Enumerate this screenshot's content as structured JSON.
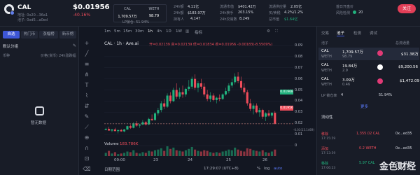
{
  "token": {
    "symbol": "CAL",
    "address_line": "地址: 0x20...36a1",
    "pair_line": "池子: 0xd5...a0ed",
    "price": "$0.01956",
    "change": "-40.16%",
    "lp_lock": "LP锁仓: 51.94%"
  },
  "pair_box": {
    "base": "CAL",
    "quote": "WETH",
    "base_amount": "1,709.57万",
    "quote_amount": "98.79"
  },
  "stats": [
    {
      "label": "24h额",
      "value": "4.11亿"
    },
    {
      "label": "24h额",
      "value": "$183.97万"
    },
    {
      "label": "持有人",
      "value": "4,147"
    },
    {
      "label": "流通市值",
      "value": "$401.42万"
    },
    {
      "label": "24h换手",
      "value": "203.15%"
    },
    {
      "label": "24h交易数",
      "value": "8,249"
    },
    {
      "label": "流通供应量",
      "value": "2.05亿"
    },
    {
      "label": "买/卖税",
      "value": "4.2%/1.2%"
    },
    {
      "label": "总市值",
      "value": "$1.64亿"
    },
    {
      "label": "首日开盘价",
      "value": ""
    },
    {
      "label": "风险检测",
      "value": "20"
    }
  ],
  "follow": "关注",
  "left_tabs": [
    "自选",
    "热门币",
    "涨幅榜",
    "新币榜"
  ],
  "left_group": "默认分组",
  "left_cols": {
    "coin": "币种",
    "price": "价格(货币)",
    "change": "24h涨跌幅"
  },
  "left_empty": "暂无数据",
  "timeframes": [
    "1m",
    "5m",
    "15m",
    "30m",
    "1h",
    "4h",
    "1D",
    "1W"
  ],
  "chart_toolbar": {
    "indicator": "指标",
    "settings": "⚙",
    "snapshot": "截图",
    "fullscreen": "⛶"
  },
  "legend": {
    "pair": "CAL · 1h · Ave.ai",
    "ohlc": "开=0.02139 高=0.02139 低=0.01834 收=0.01956 -0.00183(-8.5509%)"
  },
  "price_axis": [
    "0.09",
    "0.08",
    "0.07",
    "0.06",
    "0.05",
    "0.04",
    "0.03",
    "0.02",
    "0.01",
    "0",
    "-0.01(13.1469)"
  ],
  "price_tags": {
    "a": "0.01968",
    "b": "0.01956"
  },
  "time_axis": [
    "09:00",
    "23",
    "24",
    "25",
    "26"
  ],
  "volume_label": "Volume",
  "volume_value": "183.786K",
  "bottom_bar": {
    "range": "日期范围",
    "clock": "17:29:07 (UTC+8)",
    "pct": "%",
    "log": "log",
    "auto": "auto"
  },
  "chart_data": {
    "type": "candlestick",
    "ylim": [
      0,
      0.09
    ],
    "candles": [
      [
        0.0141,
        0.016,
        0.0138,
        0.015
      ],
      [
        0.015,
        0.017,
        0.0145,
        0.0135
      ],
      [
        0.0135,
        0.015,
        0.012,
        0.0145
      ],
      [
        0.0145,
        0.016,
        0.014,
        0.013
      ],
      [
        0.013,
        0.0142,
        0.011,
        0.014
      ],
      [
        0.014,
        0.015,
        0.0125,
        0.0128
      ],
      [
        0.0128,
        0.015,
        0.012,
        0.0145
      ],
      [
        0.0145,
        0.018,
        0.014,
        0.0175
      ],
      [
        0.0175,
        0.019,
        0.015,
        0.016
      ],
      [
        0.016,
        0.021,
        0.0155,
        0.02
      ],
      [
        0.02,
        0.022,
        0.017,
        0.018
      ],
      [
        0.018,
        0.0195,
        0.016,
        0.019
      ],
      [
        0.019,
        0.023,
        0.0185,
        0.021
      ],
      [
        0.021,
        0.022,
        0.018,
        0.019
      ],
      [
        0.019,
        0.025,
        0.0185,
        0.024
      ],
      [
        0.024,
        0.028,
        0.022,
        0.023
      ],
      [
        0.023,
        0.03,
        0.0225,
        0.029
      ],
      [
        0.029,
        0.034,
        0.027,
        0.032
      ],
      [
        0.032,
        0.04,
        0.03,
        0.038
      ],
      [
        0.038,
        0.042,
        0.033,
        0.035
      ],
      [
        0.035,
        0.047,
        0.034,
        0.045
      ],
      [
        0.045,
        0.048,
        0.038,
        0.04
      ],
      [
        0.04,
        0.052,
        0.039,
        0.05
      ],
      [
        0.05,
        0.056,
        0.042,
        0.044
      ],
      [
        0.044,
        0.052,
        0.042,
        0.048
      ],
      [
        0.048,
        0.054,
        0.043,
        0.046
      ],
      [
        0.046,
        0.052,
        0.044,
        0.051
      ],
      [
        0.051,
        0.059,
        0.049,
        0.053
      ],
      [
        0.053,
        0.062,
        0.051,
        0.06
      ],
      [
        0.06,
        0.064,
        0.05,
        0.052
      ],
      [
        0.052,
        0.058,
        0.048,
        0.056
      ],
      [
        0.056,
        0.06,
        0.051,
        0.053
      ],
      [
        0.053,
        0.056,
        0.044,
        0.046
      ],
      [
        0.046,
        0.05,
        0.04,
        0.042
      ],
      [
        0.042,
        0.048,
        0.039,
        0.045
      ],
      [
        0.045,
        0.047,
        0.04,
        0.041
      ],
      [
        0.041,
        0.044,
        0.038,
        0.043
      ],
      [
        0.043,
        0.046,
        0.04,
        0.042
      ],
      [
        0.042,
        0.047,
        0.041,
        0.046
      ],
      [
        0.046,
        0.052,
        0.045,
        0.049
      ],
      [
        0.049,
        0.056,
        0.047,
        0.054
      ],
      [
        0.054,
        0.06,
        0.052,
        0.057
      ],
      [
        0.057,
        0.065,
        0.055,
        0.062
      ],
      [
        0.062,
        0.066,
        0.056,
        0.058
      ],
      [
        0.058,
        0.062,
        0.05,
        0.052
      ],
      [
        0.052,
        0.056,
        0.046,
        0.048
      ],
      [
        0.048,
        0.05,
        0.036,
        0.038
      ],
      [
        0.038,
        0.042,
        0.031,
        0.033
      ],
      [
        0.033,
        0.038,
        0.028,
        0.036
      ],
      [
        0.036,
        0.038,
        0.029,
        0.03
      ],
      [
        0.03,
        0.034,
        0.026,
        0.032
      ],
      [
        0.032,
        0.033,
        0.024,
        0.026
      ],
      [
        0.026,
        0.03,
        0.022,
        0.029
      ],
      [
        0.029,
        0.032,
        0.026,
        0.027
      ],
      [
        0.027,
        0.03,
        0.025,
        0.0295
      ],
      [
        0.0295,
        0.031,
        0.019,
        0.0196
      ]
    ],
    "volumes": [
      0.5,
      0.8,
      0.4,
      0.6,
      0.3,
      0.4,
      0.5,
      0.7,
      0.6,
      0.9,
      0.5,
      0.4,
      0.6,
      0.5,
      0.8,
      0.7,
      0.9,
      1.0,
      1.2,
      0.8,
      1.5,
      1.1,
      1.3,
      0.9,
      0.8,
      0.7,
      0.9,
      1.1,
      1.4,
      1.0,
      0.8,
      0.7,
      0.9,
      0.8,
      0.6,
      0.5,
      0.6,
      0.5,
      0.7,
      0.8,
      1.0,
      0.9,
      1.3,
      1.0,
      0.8,
      0.7,
      1.2,
      1.1,
      0.9,
      0.8,
      0.7,
      0.9,
      0.6,
      0.5,
      0.7,
      1.0
    ]
  },
  "right_tabs": [
    "交易",
    "池子",
    "检测",
    "调试"
  ],
  "pool_header": {
    "pool": "池子",
    "tvl": "总流通量"
  },
  "pools": [
    {
      "pair": "CAL",
      "amount": "1,709.57万",
      "sub": "WETH",
      "sub_amount": "98.79",
      "value": "$31.38万",
      "color": "#e13a76"
    },
    {
      "pair": "CAL",
      "amount": "19.84万",
      "sub": "WETH",
      "sub_amount": "2.9",
      "value": "$9,200.56",
      "color": "#ffffff"
    },
    {
      "pair": "CAL",
      "amount": "3.09万",
      "sub": "WETH",
      "sub_amount": "0.46",
      "value": "$1,472.09",
      "color": "#e13a76"
    }
  ],
  "lp_row": {
    "label": "LP 锁仓率",
    "count": "4",
    "value": "51.94%"
  },
  "more": "更多",
  "trade_section": "流动性",
  "trades": [
    {
      "type": "移除",
      "time": "17:15:59",
      "amt": "1,355.02 CAL",
      "addr": "0x...ed35",
      "color": "#ee4c5a"
    },
    {
      "type": "添加",
      "time": "17:13:59",
      "amt": "0.2 WETH",
      "addr": "0x...ed35",
      "color": "#ee4c5a"
    },
    {
      "type": "移除",
      "time": "17:06:23",
      "amt": "5.97 CAL",
      "addr": "0x...a135",
      "color": "#21b17d"
    }
  ],
  "watermark": "金色财经"
}
